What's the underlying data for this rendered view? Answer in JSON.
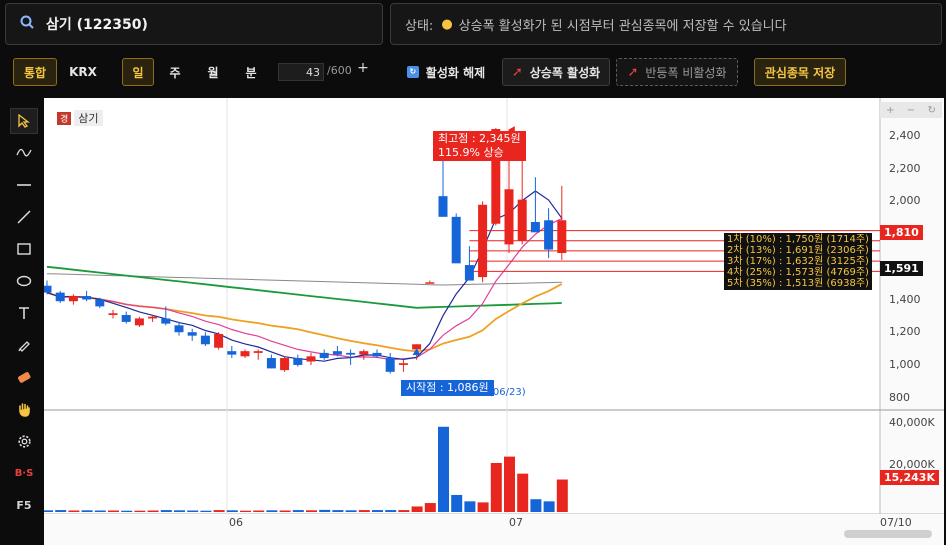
{
  "search": {
    "stock": "삼기 (122350)"
  },
  "status": {
    "prefix": "상태:",
    "message": "상승폭 활성화가 된 시점부터 관심종목에 저장할 수 있습니다"
  },
  "toolbar": {
    "market_label": "통합",
    "exchange_label": "KRX",
    "period_day": "일",
    "period_week": "주",
    "period_month": "월",
    "period_minute": "분",
    "count_value": "43",
    "count_max": "/600",
    "plus_label": "+",
    "deactivate_label": "활성화 해제",
    "rise_label": "상승폭 활성화",
    "rebound_label": "반등폭 비활성화",
    "save_label": "관심종목 저장"
  },
  "sidebar": {
    "f5_label": "F5",
    "bs_label": "B·S"
  },
  "chart": {
    "stock_badge": "경",
    "stock_name": "삼기",
    "high_label_1": "최고점 : 2,345원",
    "high_label_2": "115.9% 상승",
    "start_label": "시작점 : 1,086원",
    "start_date": "(06/23)",
    "fib_levels": [
      "1차 (10%) : 1,750원 (1714주)",
      "2차 (13%) : 1,691원 (2306주)",
      "3차 (17%) : 1,632원 (3125주)",
      "4차 (25%) : 1,573원 (4769주)",
      "5차 (35%) : 1,513원 (6938주)"
    ],
    "price_tag_red": "1,810",
    "price_tag_dark": "1,591",
    "volume_tag": "15,243K",
    "price_ticks": [
      "2,400",
      "2,200",
      "2,000",
      "1,800",
      "1,600",
      "1,400",
      "1,200",
      "1,000",
      "800"
    ],
    "volume_ticks": [
      "40,000K",
      "20,000K"
    ],
    "date_ticks": [
      "06",
      "07",
      "07/10"
    ],
    "colors": {
      "up": "#e8251f",
      "down": "#1565d8",
      "ma_fast": "#1f2a9a",
      "ma_pink": "#e0409a",
      "ma_orange": "#f0a020",
      "ma_green": "#1a9a3a",
      "ma_gray": "#888888"
    }
  },
  "chart_data": {
    "type": "candlestick",
    "price_axis": [
      800,
      2400
    ],
    "volume_axis": [
      0,
      40000
    ],
    "candles": [
      {
        "o": 1430,
        "h": 1460,
        "l": 1380,
        "c": 1390
      },
      {
        "o": 1390,
        "h": 1400,
        "l": 1330,
        "c": 1340
      },
      {
        "o": 1340,
        "h": 1380,
        "l": 1320,
        "c": 1370
      },
      {
        "o": 1370,
        "h": 1400,
        "l": 1340,
        "c": 1350
      },
      {
        "o": 1350,
        "h": 1360,
        "l": 1300,
        "c": 1310
      },
      {
        "o": 1260,
        "h": 1290,
        "l": 1240,
        "c": 1270
      },
      {
        "o": 1260,
        "h": 1280,
        "l": 1210,
        "c": 1220
      },
      {
        "o": 1200,
        "h": 1250,
        "l": 1190,
        "c": 1240
      },
      {
        "o": 1240,
        "h": 1260,
        "l": 1220,
        "c": 1250
      },
      {
        "o": 1240,
        "h": 1310,
        "l": 1200,
        "c": 1210
      },
      {
        "o": 1200,
        "h": 1220,
        "l": 1140,
        "c": 1160
      },
      {
        "o": 1160,
        "h": 1180,
        "l": 1110,
        "c": 1140
      },
      {
        "o": 1140,
        "h": 1160,
        "l": 1080,
        "c": 1090
      },
      {
        "o": 1070,
        "h": 1160,
        "l": 1060,
        "c": 1150
      },
      {
        "o": 1050,
        "h": 1080,
        "l": 1010,
        "c": 1030
      },
      {
        "o": 1020,
        "h": 1060,
        "l": 1010,
        "c": 1050
      },
      {
        "o": 1040,
        "h": 1060,
        "l": 1000,
        "c": 1050
      },
      {
        "o": 1010,
        "h": 1030,
        "l": 950,
        "c": 950
      },
      {
        "o": 940,
        "h": 1020,
        "l": 930,
        "c": 1010
      },
      {
        "o": 1010,
        "h": 1030,
        "l": 960,
        "c": 970
      },
      {
        "o": 990,
        "h": 1040,
        "l": 970,
        "c": 1020
      },
      {
        "o": 1040,
        "h": 1060,
        "l": 1000,
        "c": 1010
      },
      {
        "o": 1050,
        "h": 1080,
        "l": 1020,
        "c": 1030
      },
      {
        "o": 1040,
        "h": 1060,
        "l": 970,
        "c": 1030
      },
      {
        "o": 1030,
        "h": 1060,
        "l": 1000,
        "c": 1050
      },
      {
        "o": 1040,
        "h": 1060,
        "l": 1010,
        "c": 1020
      },
      {
        "o": 1010,
        "h": 1040,
        "l": 920,
        "c": 930
      },
      {
        "o": 970,
        "h": 1000,
        "l": 930,
        "c": 980
      },
      {
        "o": 1060,
        "h": 1090,
        "l": 1000,
        "c": 1090
      },
      {
        "o": 1450,
        "h": 1460,
        "l": 1450,
        "c": 1450
      },
      {
        "o": 1950,
        "h": 2200,
        "l": 1890,
        "c": 1830
      },
      {
        "o": 1830,
        "h": 1850,
        "l": 1670,
        "c": 1560
      },
      {
        "o": 1550,
        "h": 1660,
        "l": 1480,
        "c": 1460
      },
      {
        "o": 1480,
        "h": 1920,
        "l": 1450,
        "c": 1900
      },
      {
        "o": 1790,
        "h": 2345,
        "l": 1780,
        "c": 2340
      },
      {
        "o": 1670,
        "h": 2170,
        "l": 1620,
        "c": 1990
      },
      {
        "o": 1690,
        "h": 2210,
        "l": 1670,
        "c": 1930
      },
      {
        "o": 1800,
        "h": 2060,
        "l": 1760,
        "c": 1740
      },
      {
        "o": 1810,
        "h": 1880,
        "l": 1590,
        "c": 1640
      },
      {
        "o": 1620,
        "h": 2010,
        "l": 1580,
        "c": 1810
      }
    ],
    "volumes": [
      800,
      900,
      700,
      800,
      700,
      700,
      600,
      600,
      700,
      900,
      800,
      700,
      600,
      900,
      800,
      600,
      700,
      800,
      700,
      900,
      800,
      1000,
      900,
      800,
      900,
      900,
      900,
      900,
      2600,
      4200,
      40000,
      8000,
      5000,
      4500,
      23000,
      26000,
      18000,
      6000,
      5000,
      15243
    ]
  }
}
